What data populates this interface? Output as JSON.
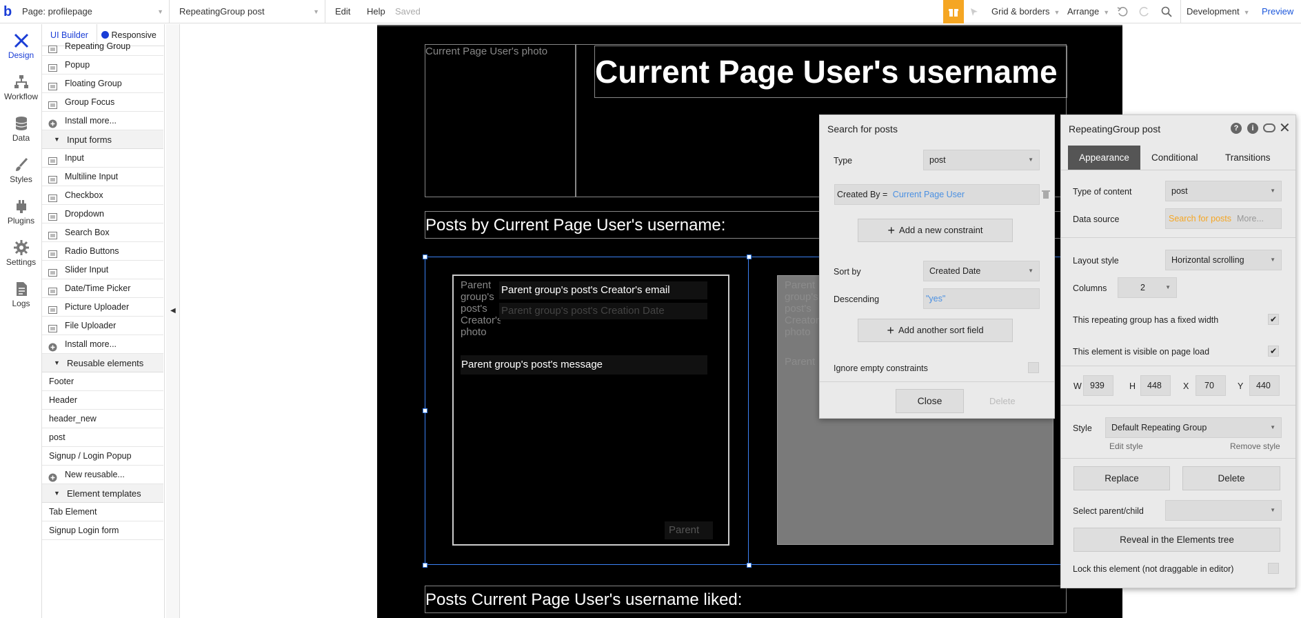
{
  "topbar": {
    "page_select": "Page: profilepage",
    "element_select": "RepeatingGroup post",
    "edit": "Edit",
    "help": "Help",
    "saved": "Saved",
    "grid": "Grid & borders",
    "arrange": "Arrange",
    "env": "Development",
    "preview": "Preview"
  },
  "leftnav": [
    "Design",
    "Workflow",
    "Data",
    "Styles",
    "Plugins",
    "Settings",
    "Logs"
  ],
  "palette": {
    "tab_ui": "UI Builder",
    "tab_responsive": "Responsive",
    "containers": [
      "Repeating Group",
      "Popup",
      "Floating Group",
      "Group Focus",
      "Install more..."
    ],
    "input_forms_header": "Input forms",
    "inputs": [
      "Input",
      "Multiline Input",
      "Checkbox",
      "Dropdown",
      "Search Box",
      "Radio Buttons",
      "Slider Input",
      "Date/Time Picker",
      "Picture Uploader",
      "File Uploader",
      "Install more..."
    ],
    "reusable_header": "Reusable elements",
    "reusables": [
      "Footer",
      "Header",
      "header_new",
      "post",
      "Signup / Login Popup",
      "New reusable..."
    ],
    "templates_header": "Element templates",
    "templates": [
      "Tab Element",
      "Signup Login form"
    ]
  },
  "canvas": {
    "photo_ph": "Current Page User's photo",
    "username_title": "Current Page User's username",
    "posts_by": "Posts by Current Page User's username:",
    "cell_photo": "Parent group's post's Creator's photo",
    "cell_email": "Parent group's post's Creator's email",
    "cell_date": "Parent group's post's Creation Date",
    "cell_message": "Parent group's post's message",
    "cell_parent": "Parent",
    "cell2_photo": "Parent group's post's Creator's photo",
    "cell2_parent": "Parent",
    "liked": "Posts Current Page User's username liked:"
  },
  "search_panel": {
    "title": "Search for posts",
    "type_label": "Type",
    "type_value": "post",
    "constraint_key": "Created By =",
    "constraint_value": "Current Page User",
    "add_constraint": "Add a new constraint",
    "sort_label": "Sort by",
    "sort_value": "Created Date",
    "desc_label": "Descending",
    "desc_value": "\"yes\"",
    "add_sort": "Add another sort field",
    "ignore_label": "Ignore empty constraints",
    "close": "Close",
    "delete": "Delete"
  },
  "prop_panel": {
    "title": "RepeatingGroup post",
    "tabs": [
      "Appearance",
      "Conditional",
      "Transitions"
    ],
    "content_type_label": "Type of content",
    "content_type_value": "post",
    "data_source_label": "Data source",
    "data_source_value": "Search for posts",
    "data_source_more": "More...",
    "layout_label": "Layout style",
    "layout_value": "Horizontal scrolling",
    "columns_label": "Columns",
    "columns_value": "2",
    "fixed_width": "This repeating group has a fixed width",
    "visible": "This element is visible on page load",
    "w_label": "W",
    "w": "939",
    "h_label": "H",
    "h": "448",
    "x_label": "X",
    "x": "70",
    "y_label": "Y",
    "y": "440",
    "style_label": "Style",
    "style_value": "Default Repeating Group",
    "edit_style": "Edit style",
    "remove_style": "Remove style",
    "replace": "Replace",
    "delete": "Delete",
    "select_parent": "Select parent/child",
    "reveal": "Reveal in the Elements tree",
    "lock": "Lock this element (not draggable in editor)"
  },
  "colors": {
    "accent": "#4a90e2",
    "brand_blue": "#1a3dd6",
    "gift": "#f5a623",
    "page_bg": "#000000",
    "panel_bg": "#eaeaea"
  }
}
